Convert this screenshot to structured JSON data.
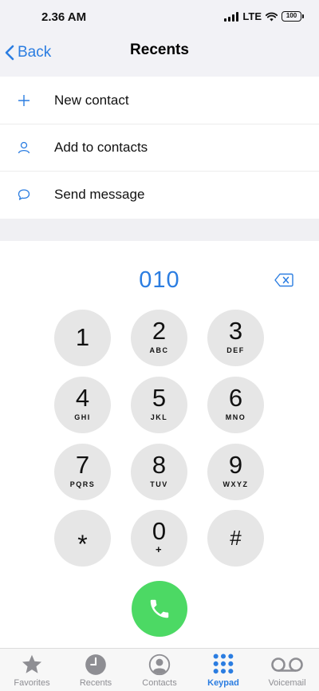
{
  "status": {
    "time": "2.36 AM",
    "network": "LTE",
    "battery": "100"
  },
  "nav": {
    "back_label": "Back",
    "title": "Recents"
  },
  "actions": [
    {
      "label": "New contact",
      "icon": "plus-icon"
    },
    {
      "label": "Add to contacts",
      "icon": "person-icon"
    },
    {
      "label": "Send message",
      "icon": "message-bubble-icon"
    }
  ],
  "dial": {
    "number": "010"
  },
  "keys": [
    {
      "digit": "1",
      "letters": ""
    },
    {
      "digit": "2",
      "letters": "ABC"
    },
    {
      "digit": "3",
      "letters": "DEF"
    },
    {
      "digit": "4",
      "letters": "GHI"
    },
    {
      "digit": "5",
      "letters": "JKL"
    },
    {
      "digit": "6",
      "letters": "MNO"
    },
    {
      "digit": "7",
      "letters": "PQRS"
    },
    {
      "digit": "8",
      "letters": "TUV"
    },
    {
      "digit": "9",
      "letters": "WXYZ"
    },
    {
      "digit": "*",
      "letters": ""
    },
    {
      "digit": "0",
      "letters": "+"
    },
    {
      "digit": "#",
      "letters": ""
    }
  ],
  "tabs": [
    {
      "label": "Favorites",
      "icon": "star-icon"
    },
    {
      "label": "Recents",
      "icon": "clock-icon"
    },
    {
      "label": "Contacts",
      "icon": "contact-icon"
    },
    {
      "label": "Keypad",
      "icon": "keypad-icon",
      "active": true
    },
    {
      "label": "Voicemail",
      "icon": "voicemail-icon"
    }
  ],
  "colors": {
    "accent": "#2b7de1",
    "call": "#4cd964",
    "key": "#e6e6e6",
    "tab_inactive": "#8e8e93"
  }
}
